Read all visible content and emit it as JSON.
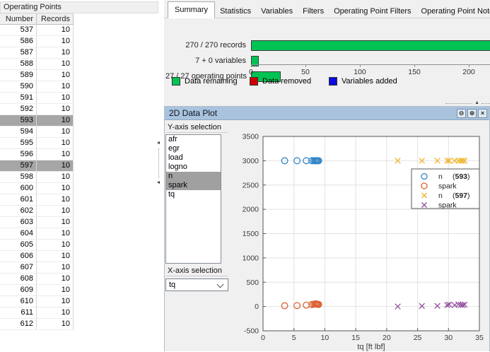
{
  "left_panel": {
    "title": "Operating Points",
    "columns": [
      "Number",
      "Records"
    ],
    "rows": [
      [
        537,
        10
      ],
      [
        586,
        10
      ],
      [
        587,
        10
      ],
      [
        588,
        10
      ],
      [
        589,
        10
      ],
      [
        590,
        10
      ],
      [
        591,
        10
      ],
      [
        592,
        10
      ],
      [
        593,
        10
      ],
      [
        594,
        10
      ],
      [
        595,
        10
      ],
      [
        596,
        10
      ],
      [
        597,
        10
      ],
      [
        598,
        10
      ],
      [
        600,
        10
      ],
      [
        601,
        10
      ],
      [
        602,
        10
      ],
      [
        603,
        10
      ],
      [
        604,
        10
      ],
      [
        605,
        10
      ],
      [
        606,
        10
      ],
      [
        607,
        10
      ],
      [
        608,
        10
      ],
      [
        609,
        10
      ],
      [
        610,
        10
      ],
      [
        611,
        10
      ],
      [
        612,
        10
      ]
    ],
    "selected_numbers": [
      593,
      597
    ]
  },
  "tabs": [
    "Summary",
    "Statistics",
    "Variables",
    "Filters",
    "Operating Point Filters",
    "Operating Point Notes"
  ],
  "active_tab": "Summary",
  "plot_panel": {
    "title": "2D Data Plot",
    "buttons": [
      {
        "name": "dock-button",
        "glyph": "⊖"
      },
      {
        "name": "maximize-button",
        "glyph": "⊕"
      },
      {
        "name": "close-button",
        "glyph": "×"
      }
    ],
    "y_axis_label": "Y-axis selection",
    "y_items": [
      "afr",
      "egr",
      "load",
      "logno",
      "n",
      "spark",
      "tq"
    ],
    "y_selected": [
      "n",
      "spark"
    ],
    "x_axis_label": "X-axis selection",
    "x_value": "tq"
  },
  "colors": {
    "bar_green": "#00c353",
    "removed_red": "#cf0000",
    "added_blue": "#0b0bde",
    "titlebar_blue": "#a9c3de",
    "selection_gray": "#a6a6a6"
  },
  "chart_data": [
    {
      "type": "bar",
      "orientation": "horizontal",
      "title": "Summary",
      "categories": [
        "270 / 270 records",
        "7 + 0 variables",
        "27 / 27 operating points"
      ],
      "values": [
        270,
        7,
        27
      ],
      "bar_color": "#00c353",
      "xticks": [
        0,
        50,
        100,
        150,
        200
      ],
      "xlim_visible": [
        0,
        220
      ],
      "grid": false,
      "legend_position": "bottom",
      "legend": [
        {
          "label": "Data remaining",
          "color": "#00c353"
        },
        {
          "label": "Data removed",
          "color": "#cf0000"
        },
        {
          "label": "Variables added",
          "color": "#0b0bde"
        }
      ]
    },
    {
      "type": "scatter",
      "xlabel": "tq [ft lbf]",
      "ylabel": "",
      "xlim": [
        0,
        35
      ],
      "ylim": [
        -500,
        3500
      ],
      "xticks": [
        0,
        5,
        10,
        15,
        20,
        25,
        30,
        35
      ],
      "yticks": [
        -500,
        0,
        500,
        1000,
        1500,
        2000,
        2500,
        3000,
        3500
      ],
      "grid": true,
      "legend_position": "upper-right",
      "series": [
        {
          "name": "n",
          "group": "593",
          "marker": "o",
          "color": "#3286c8",
          "x": [
            3.5,
            5.5,
            7.0,
            7.9,
            8.2,
            8.4,
            8.55,
            8.7,
            8.85,
            9.0
          ],
          "y": [
            3000,
            3000,
            3000,
            3000,
            3000,
            3000,
            3000,
            3000,
            3000,
            3000
          ]
        },
        {
          "name": "spark",
          "group": "",
          "marker": "o",
          "color": "#dd6030",
          "x": [
            3.5,
            5.5,
            7.0,
            7.9,
            8.2,
            8.4,
            8.55,
            8.7,
            8.85,
            9.0
          ],
          "y": [
            15,
            18,
            28,
            40,
            48,
            52,
            55,
            50,
            45,
            42
          ]
        },
        {
          "name": "n",
          "group": "597",
          "marker": "x",
          "color": "#eeb429",
          "x": [
            21.8,
            25.7,
            28.2,
            29.8,
            30.1,
            31.0,
            31.6,
            32.0,
            32.3,
            32.6
          ],
          "y": [
            3000,
            3000,
            3000,
            3000,
            3000,
            3000,
            3000,
            3000,
            3000,
            3000
          ]
        },
        {
          "name": "spark",
          "group": "",
          "marker": "x",
          "color": "#94519f",
          "x": [
            21.8,
            25.7,
            28.2,
            29.8,
            30.1,
            31.0,
            31.6,
            32.0,
            32.3,
            32.6
          ],
          "y": [
            0,
            10,
            12,
            30,
            40,
            28,
            45,
            35,
            30,
            38
          ]
        }
      ],
      "legend": [
        {
          "marker": "o",
          "color": "#3286c8",
          "label": "n",
          "group": "593"
        },
        {
          "marker": "o",
          "color": "#dd6030",
          "label": "spark",
          "group": ""
        },
        {
          "marker": "x",
          "color": "#eeb429",
          "label": "n",
          "group": "597"
        },
        {
          "marker": "x",
          "color": "#94519f",
          "label": "spark",
          "group": ""
        }
      ]
    }
  ]
}
